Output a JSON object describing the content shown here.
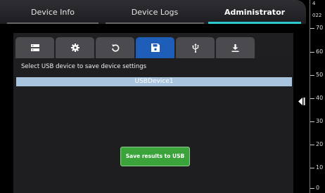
{
  "tabs": [
    {
      "label": "Device Info"
    },
    {
      "label": "Device Logs"
    },
    {
      "label": "Administrator",
      "active": true
    }
  ],
  "toolbar": {
    "tools": [
      {
        "icon": "server-icon"
      },
      {
        "icon": "gear-icon"
      },
      {
        "icon": "undo-icon"
      },
      {
        "icon": "save-icon",
        "active": true
      },
      {
        "icon": "usb-icon"
      },
      {
        "icon": "download-icon"
      }
    ]
  },
  "main": {
    "prompt": "Select USB device to save device settings",
    "devices": [
      "USBDevice1"
    ],
    "save_button": "Save results to USB"
  },
  "gauge": {
    "top_label_1": "4",
    "top_label_2": "022",
    "ticks": [
      "70",
      "60",
      "50",
      "40",
      "30",
      "20",
      "10",
      "0"
    ]
  },
  "colors": {
    "accent": "#2ec8cf",
    "active_tool": "#1e5db8",
    "button": "#3aa33a",
    "selection": "#a9c4de"
  }
}
